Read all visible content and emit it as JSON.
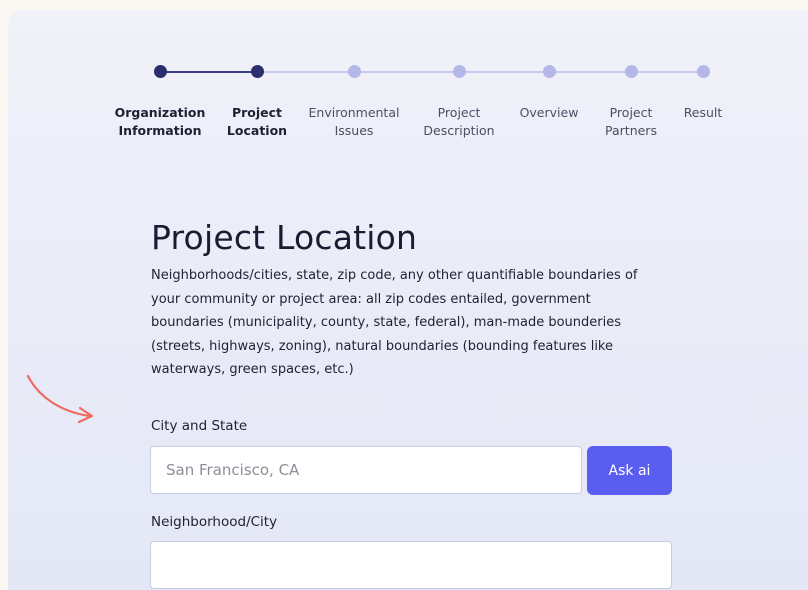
{
  "stepper": {
    "steps": [
      {
        "label": "Organization\nInformation",
        "status": "done"
      },
      {
        "label": "Project\nLocation",
        "status": "current"
      },
      {
        "label": "Environmental\nIssues",
        "status": "todo"
      },
      {
        "label": "Project\nDescription",
        "status": "todo"
      },
      {
        "label": "Overview",
        "status": "todo"
      },
      {
        "label": "Project\nPartners",
        "status": "todo"
      },
      {
        "label": "Result",
        "status": "todo"
      }
    ]
  },
  "page": {
    "title": "Project Location",
    "description": "Neighborhoods/cities, state, zip code, any other quantifiable boundaries of your community or project area: all zip codes entailed, government boundaries (municipality, county, state, federal), man-made bounderies (streets, highways, zoning), natural boundaries (bounding features like waterways, green spaces, etc.)"
  },
  "form": {
    "city_label": "City and State",
    "city_placeholder": "San Francisco, CA",
    "city_value": "",
    "ask_ai_label": "Ask ai",
    "neighborhood_label": "Neighborhood/City",
    "neighborhood_value": ""
  },
  "colors": {
    "accent": "#5a5ef0",
    "step_done": "#2b2d6e",
    "step_todo": "#b4b7e8",
    "annotation_arrow": "#ee6b63"
  },
  "icons": {
    "annotation": "curved-arrow-icon"
  }
}
